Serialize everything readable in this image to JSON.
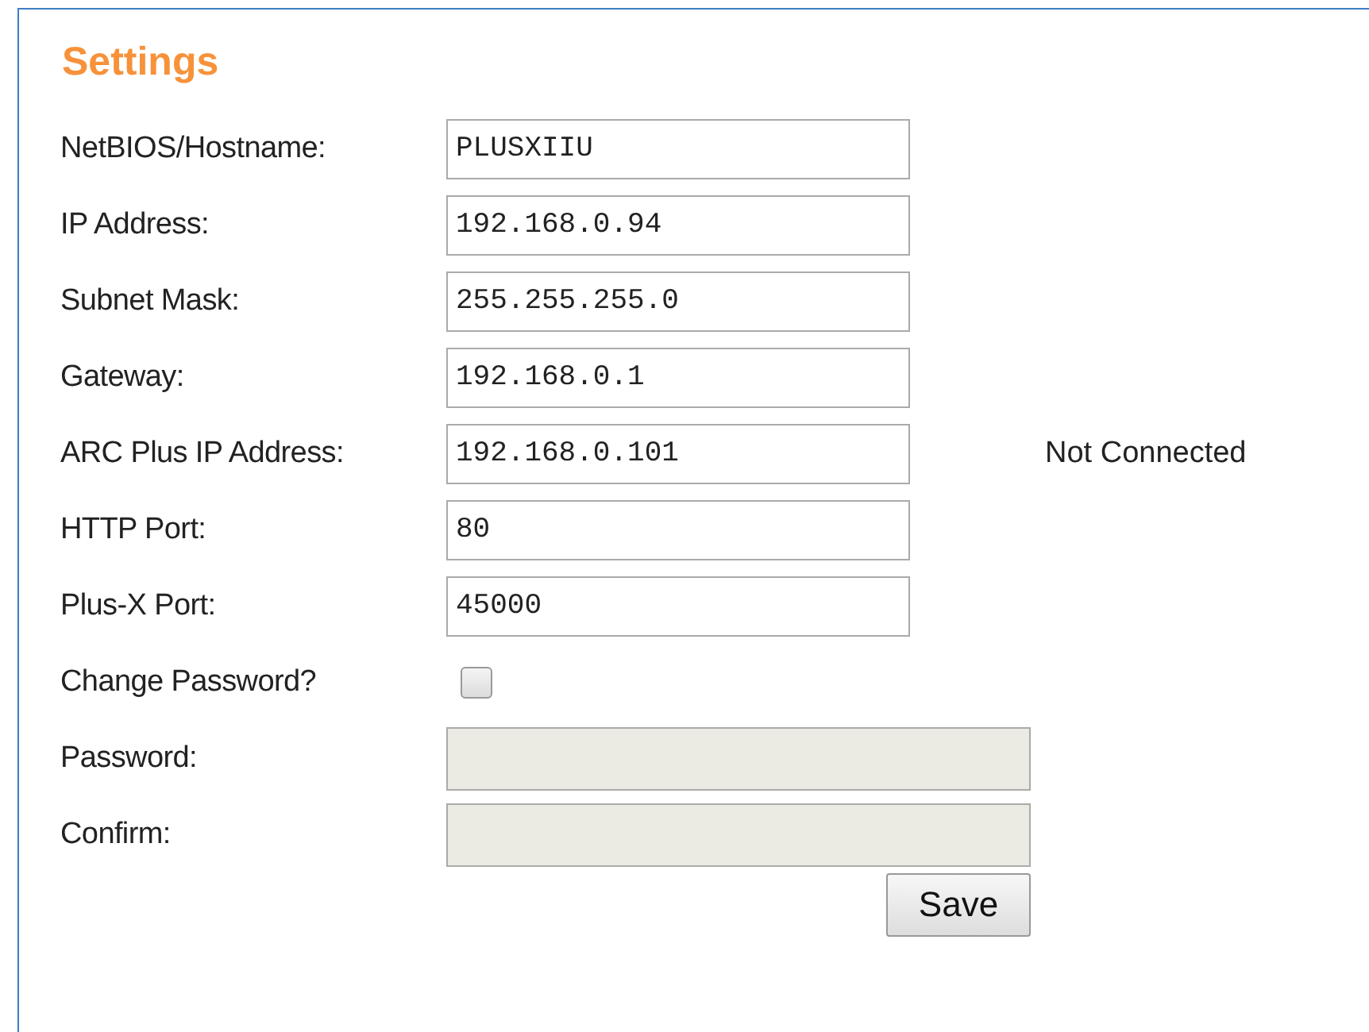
{
  "title": "Settings",
  "fields": [
    {
      "kind": "text",
      "label": "NetBIOS/Hostname:",
      "value": "PLUSXIIU"
    },
    {
      "kind": "text",
      "label": "IP Address:",
      "value": "192.168.0.94"
    },
    {
      "kind": "text",
      "label": "Subnet Mask:",
      "value": "255.255.255.0"
    },
    {
      "kind": "text",
      "label": "Gateway:",
      "value": "192.168.0.1"
    },
    {
      "kind": "text",
      "label": "ARC Plus IP Address:",
      "value": "192.168.0.101",
      "status": "Not Connected"
    },
    {
      "kind": "text",
      "label": "HTTP Port:",
      "value": "80"
    },
    {
      "kind": "text",
      "label": "Plus-X Port:",
      "value": "45000"
    },
    {
      "kind": "checkbox",
      "label": "Change Password?",
      "checked": false
    },
    {
      "kind": "password",
      "label": "Password:",
      "disabled": true
    },
    {
      "kind": "password",
      "label": "Confirm:",
      "disabled": true
    }
  ],
  "save_button": "Save"
}
